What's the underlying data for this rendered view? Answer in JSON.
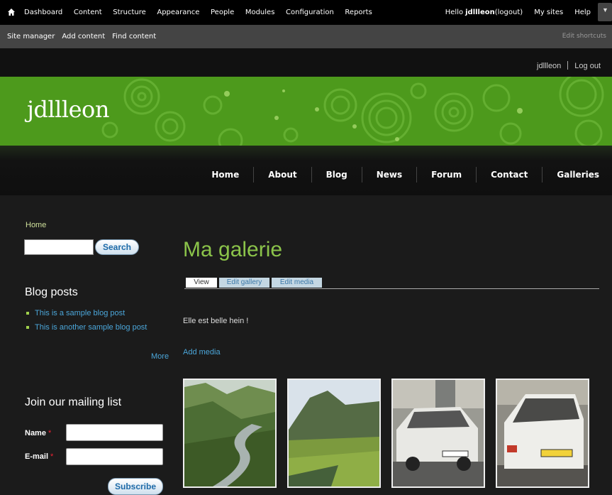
{
  "toolbar": {
    "menu": [
      "Dashboard",
      "Content",
      "Structure",
      "Appearance",
      "People",
      "Modules",
      "Configuration",
      "Reports"
    ],
    "hello": "Hello",
    "username": "jdllleon",
    "logout": "(logout)",
    "my_sites": "My sites",
    "help": "Help"
  },
  "shortcuts": {
    "items": [
      "Site manager",
      "Add content",
      "Find content"
    ],
    "edit": "Edit shortcuts"
  },
  "account": {
    "user": "jdllleon",
    "logout": "Log out"
  },
  "site": {
    "name": "jdllleon"
  },
  "nav": [
    "Home",
    "About",
    "Blog",
    "News",
    "Forum",
    "Contact",
    "Galleries"
  ],
  "sidebar": {
    "breadcrumb": "Home",
    "search_button": "Search",
    "blog_heading": "Blog posts",
    "blog_posts": [
      "This is a sample blog post",
      "This is another sample blog post"
    ],
    "more": "More",
    "mailing_heading": "Join our mailing list",
    "name_label": "Name",
    "email_label": "E-mail",
    "required_mark": "*",
    "subscribe": "Subscribe"
  },
  "content": {
    "title": "Ma galerie",
    "tabs": [
      "View",
      "Edit gallery",
      "Edit media"
    ],
    "body": "Elle est belle hein !",
    "add_media": "Add media"
  },
  "colors": {
    "accent_green": "#8bc34a",
    "link_blue": "#4ba6d9",
    "banner_green": "#4d9a1c"
  }
}
